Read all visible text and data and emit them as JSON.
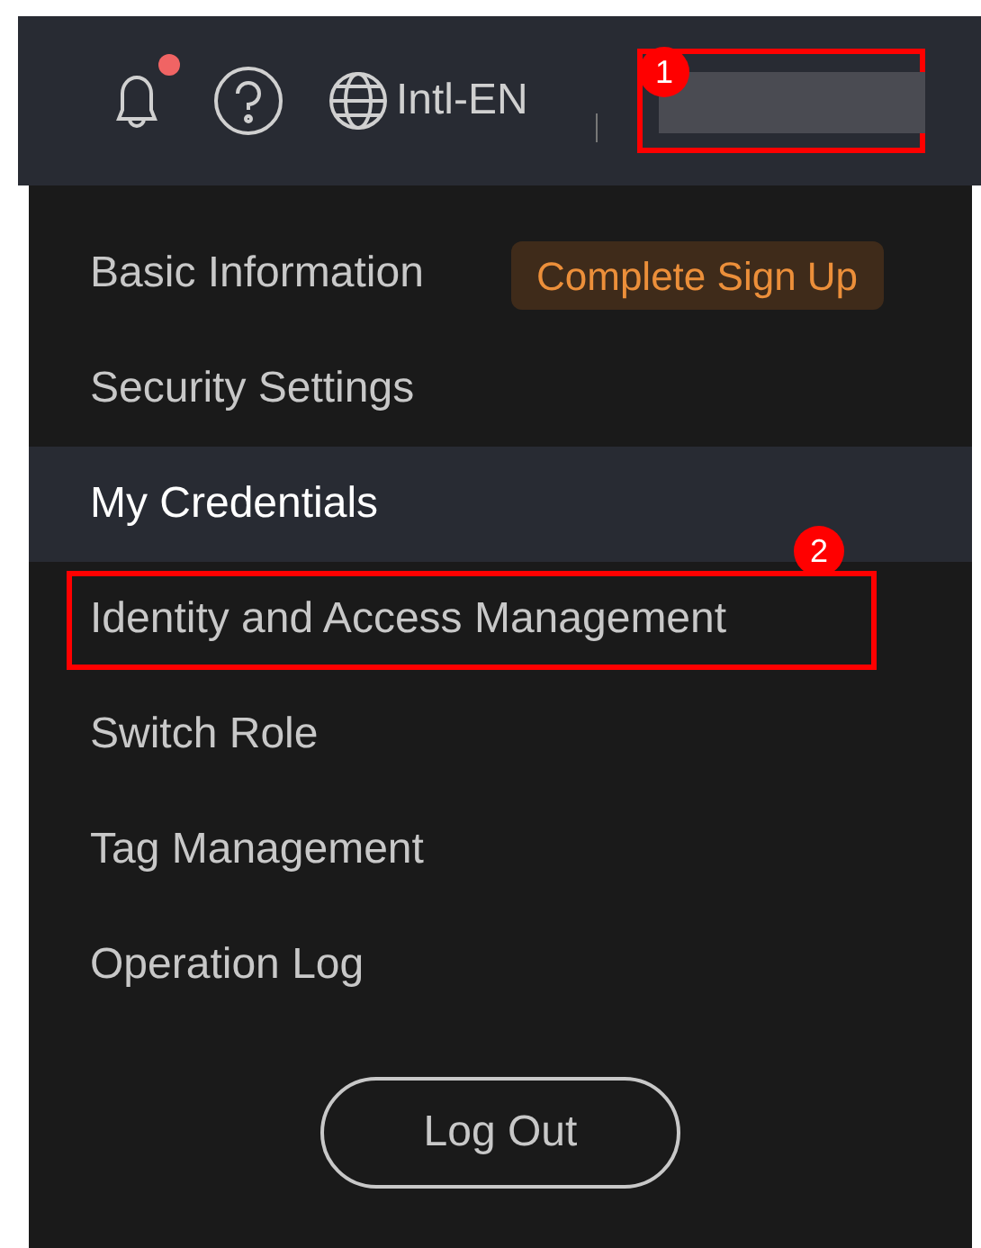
{
  "top_bar": {
    "has_notification": true,
    "language": "Intl-EN",
    "account_callout": "1"
  },
  "menu": {
    "items": [
      {
        "label": "Basic Information",
        "selected": false,
        "badge": "Complete Sign Up"
      },
      {
        "label": "Security Settings",
        "selected": false
      },
      {
        "label": "My Credentials",
        "selected": true
      },
      {
        "label": "Identity and Access Management",
        "selected": false,
        "callout": "2"
      },
      {
        "label": "Switch Role",
        "selected": false
      },
      {
        "label": "Tag Management",
        "selected": false
      },
      {
        "label": "Operation Log",
        "selected": false
      }
    ],
    "logout": "Log Out"
  }
}
